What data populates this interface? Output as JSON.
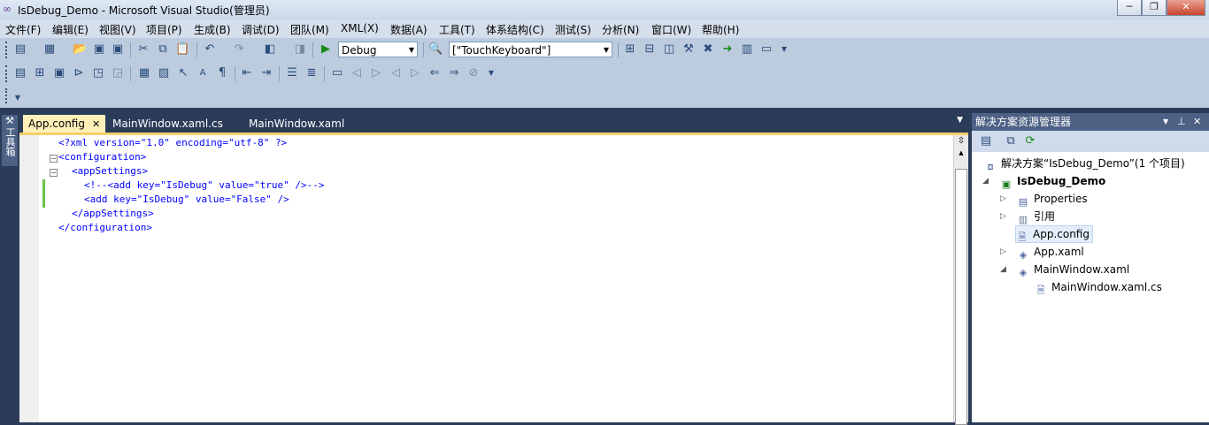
{
  "window": {
    "title": "IsDebug_Demo - Microsoft Visual Studio(管理员)",
    "minimize": "─",
    "restore": "❐",
    "close": "✕"
  },
  "menu": [
    "文件(F)",
    "编辑(E)",
    "视图(V)",
    "项目(P)",
    "生成(B)",
    "调试(D)",
    "团队(M)",
    "XML(X)",
    "数据(A)",
    "工具(T)",
    "体系结构(C)",
    "测试(S)",
    "分析(N)",
    "窗口(W)",
    "帮助(H)"
  ],
  "toolbar": {
    "config_value": "Debug",
    "platform_value": "[\"TouchKeyboard\"]"
  },
  "left_sidebar": {
    "label": "工具箱"
  },
  "tabs": [
    {
      "label": "App.config",
      "close": "✕"
    },
    {
      "label": "MainWindow.xaml.cs"
    },
    {
      "label": "MainWindow.xaml"
    }
  ],
  "code": {
    "line1": "<?xml version=\"1.0\" encoding=\"utf-8\" ?>",
    "line2": "<configuration>",
    "line3": "<appSettings>",
    "line4": "<!--<add key=\"IsDebug\" value=\"true\" />-->",
    "line5": "<add key=\"IsDebug\" value=\"False\" />",
    "line6": "</appSettings>",
    "line7": "</configuration>"
  },
  "solution_explorer": {
    "title": "解决方案资源管理器",
    "solution": "解决方案“IsDebug_Demo”(1 个项目)",
    "project": "IsDebug_Demo",
    "items": [
      "Properties",
      "引用",
      "App.config",
      "App.xaml",
      "MainWindow.xaml",
      "MainWindow.xaml.cs"
    ]
  }
}
